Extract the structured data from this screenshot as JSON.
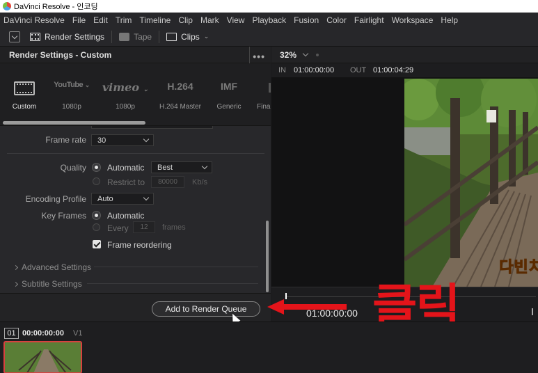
{
  "window": {
    "title": "DaVinci Resolve - 인코딩"
  },
  "menu": [
    "DaVinci Resolve",
    "File",
    "Edit",
    "Trim",
    "Timeline",
    "Clip",
    "Mark",
    "View",
    "Playback",
    "Fusion",
    "Color",
    "Fairlight",
    "Workspace",
    "Help"
  ],
  "toolbar": {
    "render_settings": "Render Settings",
    "tape": "Tape",
    "clips": "Clips"
  },
  "panel": {
    "title": "Render Settings - Custom",
    "presets": [
      {
        "logo": "",
        "label": "Custom",
        "icon": "film-icon"
      },
      {
        "logo": "YouTube",
        "label": "1080p",
        "icon": "youtube-icon"
      },
      {
        "logo": "vimeo",
        "label": "1080p",
        "icon": "vimeo-icon"
      },
      {
        "logo": "H.264",
        "label": "H.264 Master",
        "icon": ""
      },
      {
        "logo": "IMF",
        "label": "Generic",
        "icon": ""
      },
      {
        "logo": "",
        "label": "Final",
        "icon": ""
      }
    ],
    "frame_rate": {
      "label": "Frame rate",
      "value": "30"
    },
    "quality": {
      "label": "Quality",
      "automatic": "Automatic",
      "automatic_value": "Best",
      "restrict": "Restrict to",
      "restrict_value": "80000",
      "restrict_unit": "Kb/s"
    },
    "encoding_profile": {
      "label": "Encoding Profile",
      "value": "Auto"
    },
    "key_frames": {
      "label": "Key Frames",
      "automatic": "Automatic",
      "every": "Every",
      "every_value": "12",
      "every_unit": "frames"
    },
    "frame_reordering": "Frame reordering",
    "sections": [
      "Advanced Settings",
      "Subtitle Settings"
    ],
    "add_button": "Add to Render Queue"
  },
  "viewer": {
    "zoom": "32%",
    "in_label": "IN",
    "in_value": "01:00:00:00",
    "out_label": "OUT",
    "out_value": "01:00:04:29",
    "subtitle": "다빈치",
    "timecode": "01:00:00:00"
  },
  "annotation": {
    "text": "클릭",
    "color": "#e4141a"
  },
  "clip": {
    "number": "01",
    "timecode": "00:00:00:00",
    "track": "V1"
  }
}
